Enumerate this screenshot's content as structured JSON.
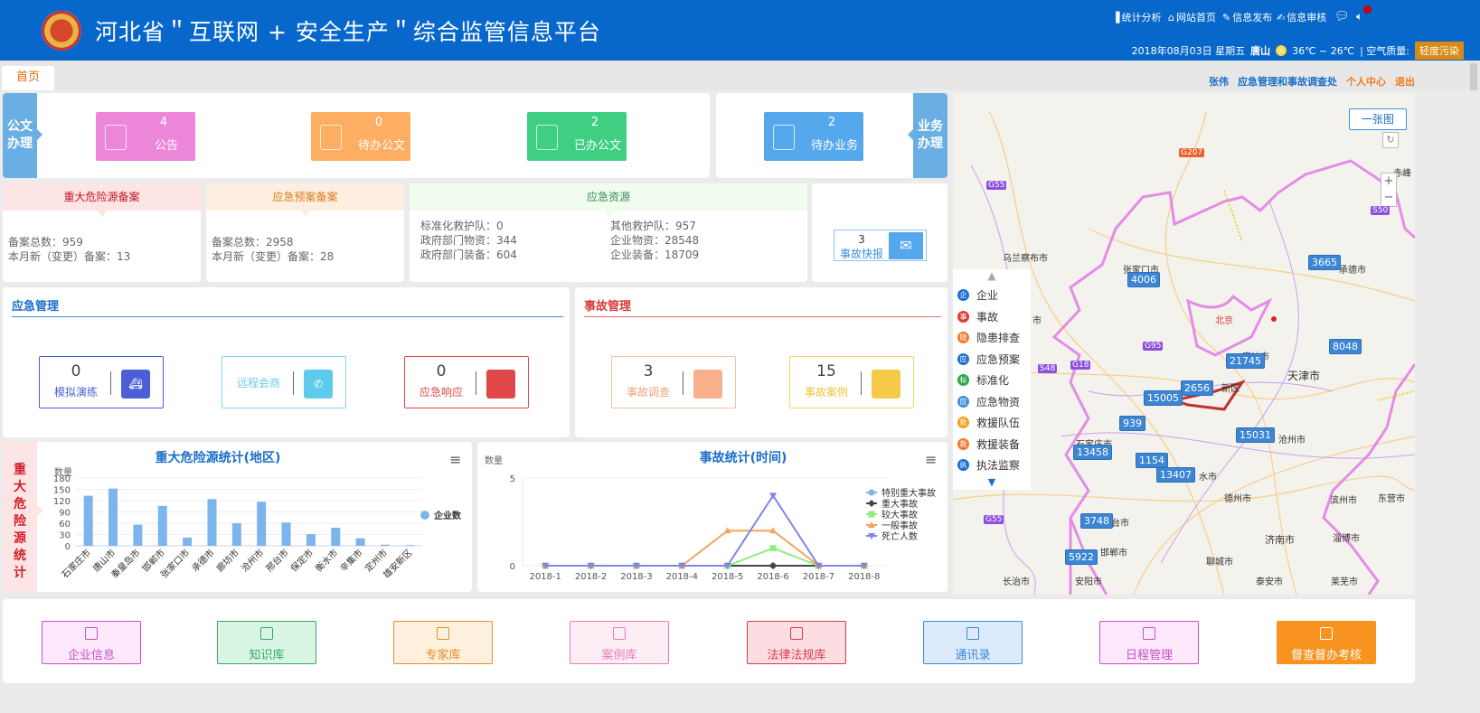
{
  "header": {
    "title": "河北省＂互联网 + 安全生产＂综合监管信息平台",
    "links": [
      "统计分析",
      "网站首页",
      "信息发布",
      "信息审核"
    ],
    "date": "2018年08月03日 星期五",
    "city": "唐山",
    "temperature": "36℃ ~ 26℃",
    "air_label": "| 空气质量:",
    "air_quality": "轻度污染",
    "air_color": "#d78a14"
  },
  "tabs": [
    {
      "label": "首页",
      "active": true
    }
  ],
  "user": {
    "name": "张伟",
    "dept": "应急管理和事故调查处",
    "center": "个人中心",
    "logout": "退出"
  },
  "docs": {
    "label": "公文办理",
    "cards": [
      {
        "count": "4",
        "label": "公告",
        "color": "#ec86d9"
      },
      {
        "count": "0",
        "label": "待办公文",
        "color": "#fdae62"
      },
      {
        "count": "2",
        "label": "已办公文",
        "color": "#3ecf83"
      }
    ]
  },
  "business": {
    "label": "业务办理",
    "card": {
      "count": "2",
      "label": "待办业务",
      "color": "#56a8ec"
    }
  },
  "stats": [
    {
      "title": "重大危险源备案",
      "lines": [
        "备案总数：959",
        "本月新（变更）备案：13"
      ]
    },
    {
      "title": "应急预案备案",
      "lines": [
        "备案总数：2958",
        "本月新（变更）备案：28"
      ]
    },
    {
      "title": "应急资源",
      "left": [
        "标准化救护队：0",
        "政府部门物资：344",
        "政府部门装备：604"
      ],
      "right": [
        "其他救护队：957",
        "企业物资：28548",
        "企业装备：18709"
      ]
    }
  ],
  "quick_report": {
    "count": "3",
    "label": "事故快报"
  },
  "emergency": {
    "title": "应急管理",
    "items": [
      {
        "count": "0",
        "label": "模拟演练"
      },
      {
        "count": "",
        "label": "远程会商"
      },
      {
        "count": "0",
        "label": "应急响应"
      }
    ]
  },
  "accident": {
    "title": "事故管理",
    "items": [
      {
        "count": "3",
        "label": "事故调查"
      },
      {
        "count": "15",
        "label": "事故案例"
      }
    ]
  },
  "hazard_side_label": "重大危险源统计",
  "chart_data": [
    {
      "type": "bar",
      "title": "重大危险源统计(地区)",
      "ylabel": "数量",
      "ylim": [
        0,
        180
      ],
      "yticks": [
        0,
        30,
        60,
        90,
        120,
        150,
        180
      ],
      "grid": true,
      "legend": "right",
      "categories": [
        "石家庄市",
        "唐山市",
        "秦皇岛市",
        "邯郸市",
        "张家口市",
        "承德市",
        "廊坊市",
        "沧州市",
        "邢台市",
        "保定市",
        "衡水市",
        "辛集市",
        "定州市",
        "雄安新区"
      ],
      "series": [
        {
          "name": "企业数",
          "color": "#7cb5ec",
          "values": [
            133,
            152,
            56,
            106,
            22,
            124,
            60,
            117,
            62,
            31,
            48,
            20,
            3,
            2
          ]
        }
      ]
    },
    {
      "type": "line",
      "title": "事故统计(时间)",
      "ylabel": "数量",
      "ylim": [
        0,
        5
      ],
      "yticks": [
        0,
        5
      ],
      "legend": "right",
      "categories": [
        "2018-1",
        "2018-2",
        "2018-3",
        "2018-4",
        "2018-5",
        "2018-6",
        "2018-7",
        "2018-8"
      ],
      "series": [
        {
          "name": "特别重大事故",
          "color": "#7cb5ec",
          "marker": "circle",
          "values": [
            0,
            0,
            0,
            0,
            0,
            0,
            0,
            0
          ]
        },
        {
          "name": "重大事故",
          "color": "#434348",
          "marker": "diamond",
          "values": [
            0,
            0,
            0,
            0,
            0,
            0,
            0,
            0
          ]
        },
        {
          "name": "较大事故",
          "color": "#90ed7d",
          "marker": "square",
          "values": [
            0,
            0,
            0,
            0,
            0,
            1,
            0,
            0
          ]
        },
        {
          "name": "一般事故",
          "color": "#f7a35c",
          "marker": "triangle",
          "values": [
            0,
            0,
            0,
            0,
            2,
            2,
            0,
            0
          ]
        },
        {
          "name": "死亡人数",
          "color": "#8085e9",
          "marker": "triangle-down",
          "values": [
            0,
            0,
            0,
            0,
            0,
            4,
            0,
            0
          ]
        }
      ]
    }
  ],
  "map": {
    "button": "一张图",
    "legend": [
      "企业",
      "事故",
      "隐患排查",
      "应急预案",
      "标准化",
      "应急物资",
      "救援队伍",
      "救援装备",
      "执法监察"
    ],
    "legend_colors": [
      "#1a6fd1",
      "#e03b3b",
      "#f07a2a",
      "#1a6fd1",
      "#2aa84a",
      "#3a8fe0",
      "#f0a020",
      "#f07a2a",
      "#1a6fd1"
    ],
    "markers": [
      "4006",
      "3665",
      "8048",
      "21745",
      "2656",
      "15005",
      "939",
      "13458",
      "1154",
      "13407",
      "15031",
      "3748",
      "5922"
    ],
    "cities": [
      "乌兰察布市",
      "张家口市",
      "承德市",
      "北京",
      "廊坊市",
      "天津市",
      "石家庄市",
      "新区",
      "沧州市",
      "水市",
      "德州市",
      "滨州市",
      "东营市",
      "邢台市",
      "济南市",
      "淄博市",
      "邯郸市",
      "聊城市",
      "长治市",
      "安阳市",
      "泰安市",
      "莱芜市",
      "赤峰",
      "市"
    ],
    "roads": [
      "G207",
      "G55",
      "S50",
      "G95",
      "S48",
      "G18",
      "G55"
    ]
  },
  "bottom": [
    {
      "label": "企业信息",
      "color": "#c84fc8",
      "bg": "#fde9fb"
    },
    {
      "label": "知识库",
      "color": "#3aa763",
      "bg": "#d9f5e3"
    },
    {
      "label": "专家库",
      "color": "#e88d2a",
      "bg": "#fdf0dd"
    },
    {
      "label": "案例库",
      "color": "#e87ab8",
      "bg": "#fdeef6"
    },
    {
      "label": "法律法规库",
      "color": "#d93b4e",
      "bg": "#fcdde1"
    },
    {
      "label": "通讯录",
      "color": "#3b87d3",
      "bg": "#dcebfb"
    },
    {
      "label": "日程管理",
      "color": "#c84fc8",
      "bg": "#fde9fb"
    },
    {
      "label": "督查督办考核",
      "color": "#fff",
      "bg": "#f7931e"
    }
  ]
}
